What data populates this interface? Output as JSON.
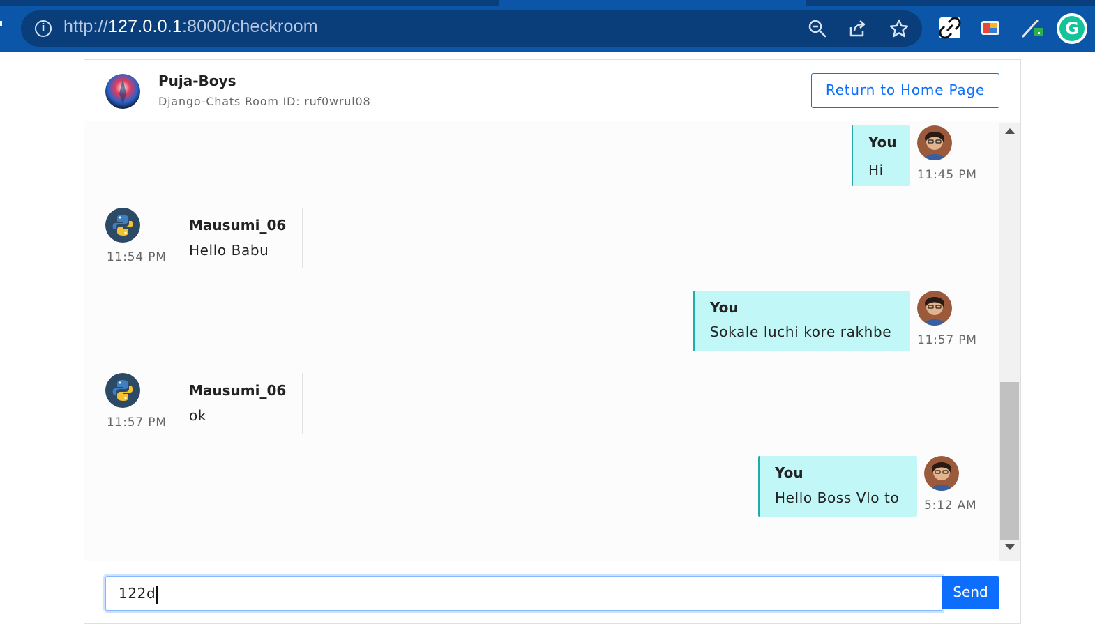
{
  "browser": {
    "url_prefix": "http://",
    "url_host": "127.0.0.1",
    "url_rest": ":8000/checkroom",
    "icons": [
      "info-icon",
      "zoom-icon",
      "share-icon",
      "bookmark-star-icon",
      "link-extension-icon",
      "color-extension-icon",
      "pen-extension-icon",
      "grammarly-icon"
    ],
    "info_glyph": "i",
    "grammarly_glyph": "G"
  },
  "header": {
    "room_name": "Puja-Boys",
    "room_id_label": "Django-Chats Room ID: ruf0wrul08",
    "home_button_label": "Return to Home Page"
  },
  "messages": [
    {
      "direction": "out",
      "sender": "You",
      "text": "Hi",
      "time": "11:45 PM"
    },
    {
      "direction": "in",
      "sender": "Mausumi_06",
      "text": "Hello Babu",
      "time": "11:54 PM"
    },
    {
      "direction": "out",
      "sender": "You",
      "text": "Sokale luchi kore rakhbe",
      "time": "11:57 PM"
    },
    {
      "direction": "in",
      "sender": "Mausumi_06",
      "text": "ok",
      "time": "11:57 PM"
    },
    {
      "direction": "out",
      "sender": "You",
      "text": "Hello Boss Vlo to",
      "time": "5:12 AM"
    }
  ],
  "footer": {
    "input_value": "122d",
    "send_label": "Send"
  },
  "colors": {
    "browser_bar": "#0b56a8",
    "outgoing_bubble": "#c2f7f8",
    "accent": "#0d6efd"
  }
}
